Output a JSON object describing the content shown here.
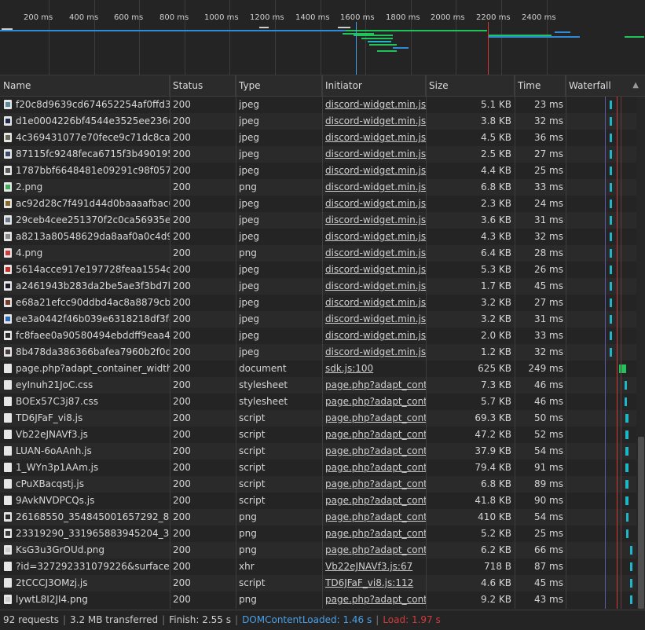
{
  "overview": {
    "ticks": [
      "200 ms",
      "400 ms",
      "600 ms",
      "800 ms",
      "1000 ms",
      "1200 ms",
      "1400 ms",
      "1600 ms",
      "1800 ms",
      "2000 ms",
      "2200 ms",
      "2400 ms"
    ]
  },
  "columns": {
    "name": "Name",
    "status": "Status",
    "type": "Type",
    "initiator": "Initiator",
    "size": "Size",
    "time": "Time",
    "waterfall": "Waterfall"
  },
  "rows": [
    {
      "name": "f20c8d9639cd674652254af0ffd3e...",
      "status": "200",
      "type": "jpeg",
      "initiator": "discord-widget.min.js:1",
      "size": "5.1 KB",
      "time": "23 ms",
      "icon": "image-file-icon",
      "color": "#5a8a9a"
    },
    {
      "name": "d1e0004226bf4544e3525ee236cd...",
      "status": "200",
      "type": "jpeg",
      "initiator": "discord-widget.min.js:1",
      "size": "3.8 KB",
      "time": "32 ms",
      "icon": "image-file-icon",
      "color": "#1d2b52"
    },
    {
      "name": "4c369431077e70fece9c71dc8ca28...",
      "status": "200",
      "type": "jpeg",
      "initiator": "discord-widget.min.js:1",
      "size": "4.5 KB",
      "time": "36 ms",
      "icon": "image-file-icon",
      "color": "#6a6a5a"
    },
    {
      "name": "87115fc9248feca6715f3b4901956...",
      "status": "200",
      "type": "jpeg",
      "initiator": "discord-widget.min.js:1",
      "size": "2.5 KB",
      "time": "27 ms",
      "icon": "image-file-icon",
      "color": "#3a4a6a"
    },
    {
      "name": "1787bbf6648481e09291c98f0577...",
      "status": "200",
      "type": "jpeg",
      "initiator": "discord-widget.min.js:1",
      "size": "4.4 KB",
      "time": "25 ms",
      "icon": "image-file-icon",
      "color": "#5a5a5a"
    },
    {
      "name": "2.png",
      "status": "200",
      "type": "png",
      "initiator": "discord-widget.min.js:1",
      "size": "6.8 KB",
      "time": "33 ms",
      "icon": "image-file-icon",
      "color": "#3fae5a"
    },
    {
      "name": "ac92d28c7f491d44d0baaaafbac60...",
      "status": "200",
      "type": "jpeg",
      "initiator": "discord-widget.min.js:1",
      "size": "2.3 KB",
      "time": "24 ms",
      "icon": "image-file-icon",
      "color": "#8a6a2a"
    },
    {
      "name": "29ceb4cee251370f2c0ca56935ea0...",
      "status": "200",
      "type": "jpeg",
      "initiator": "discord-widget.min.js:1",
      "size": "3.6 KB",
      "time": "31 ms",
      "icon": "image-file-icon",
      "color": "#6a7a8a"
    },
    {
      "name": "a8213a80548629da8aaf0a0c4d93...",
      "status": "200",
      "type": "jpeg",
      "initiator": "discord-widget.min.js:1",
      "size": "4.3 KB",
      "time": "32 ms",
      "icon": "image-file-icon",
      "color": "#8a8a8a"
    },
    {
      "name": "4.png",
      "status": "200",
      "type": "png",
      "initiator": "discord-widget.min.js:1",
      "size": "6.4 KB",
      "time": "28 ms",
      "icon": "image-file-icon",
      "color": "#d03a3a"
    },
    {
      "name": "5614acce917e197728feaa1554c64...",
      "status": "200",
      "type": "jpeg",
      "initiator": "discord-widget.min.js:1",
      "size": "5.3 KB",
      "time": "26 ms",
      "icon": "image-file-icon",
      "color": "#c0302a"
    },
    {
      "name": "a2461943b283da2be5ae3f3bd7bc...",
      "status": "200",
      "type": "jpeg",
      "initiator": "discord-widget.min.js:1",
      "size": "1.7 KB",
      "time": "45 ms",
      "icon": "image-file-icon",
      "color": "#1a1a2a"
    },
    {
      "name": "e68a21efcc90ddbd4ac8a8879cb2...",
      "status": "200",
      "type": "jpeg",
      "initiator": "discord-widget.min.js:1",
      "size": "3.2 KB",
      "time": "27 ms",
      "icon": "image-file-icon",
      "color": "#7a3a2a"
    },
    {
      "name": "ee3a0442f46b039e6318218df3f85...",
      "status": "200",
      "type": "jpeg",
      "initiator": "discord-widget.min.js:1",
      "size": "3.2 KB",
      "time": "31 ms",
      "icon": "image-file-icon",
      "color": "#2a6ac0"
    },
    {
      "name": "fc8faee0a90580494ebddff9eaa46...",
      "status": "200",
      "type": "jpeg",
      "initiator": "discord-widget.min.js:1",
      "size": "2.0 KB",
      "time": "33 ms",
      "icon": "image-file-icon",
      "color": "#2a2a2a"
    },
    {
      "name": "8b478da386366bafea7960b2f0d5...",
      "status": "200",
      "type": "jpeg",
      "initiator": "discord-widget.min.js:1",
      "size": "1.2 KB",
      "time": "32 ms",
      "icon": "image-file-icon",
      "color": "#4a3a3a"
    },
    {
      "name": "page.php?adapt_container_width...",
      "status": "200",
      "type": "document",
      "initiator": "sdk.js:100",
      "size": "625 KB",
      "time": "249 ms",
      "icon": "document-file-icon",
      "color": ""
    },
    {
      "name": "eyInuh21JoC.css",
      "status": "200",
      "type": "stylesheet",
      "initiator": "page.php?adapt_cont...",
      "size": "7.3 KB",
      "time": "46 ms",
      "icon": "stylesheet-file-icon",
      "color": ""
    },
    {
      "name": "BOEx57C3j87.css",
      "status": "200",
      "type": "stylesheet",
      "initiator": "page.php?adapt_cont...",
      "size": "5.7 KB",
      "time": "46 ms",
      "icon": "stylesheet-file-icon",
      "color": ""
    },
    {
      "name": "TD6JFaF_vi8.js",
      "status": "200",
      "type": "script",
      "initiator": "page.php?adapt_cont...",
      "size": "69.3 KB",
      "time": "50 ms",
      "icon": "script-file-icon",
      "color": ""
    },
    {
      "name": "Vb22eJNAVf3.js",
      "status": "200",
      "type": "script",
      "initiator": "page.php?adapt_cont...",
      "size": "47.2 KB",
      "time": "52 ms",
      "icon": "script-file-icon",
      "color": ""
    },
    {
      "name": "LUAN-6oAAnh.js",
      "status": "200",
      "type": "script",
      "initiator": "page.php?adapt_cont...",
      "size": "37.9 KB",
      "time": "54 ms",
      "icon": "script-file-icon",
      "color": ""
    },
    {
      "name": "1_WYn3p1AAm.js",
      "status": "200",
      "type": "script",
      "initiator": "page.php?adapt_cont...",
      "size": "79.4 KB",
      "time": "91 ms",
      "icon": "script-file-icon",
      "color": ""
    },
    {
      "name": "cPuXBacqstj.js",
      "status": "200",
      "type": "script",
      "initiator": "page.php?adapt_cont...",
      "size": "6.8 KB",
      "time": "89 ms",
      "icon": "script-file-icon",
      "color": ""
    },
    {
      "name": "9AvkNVDPCQs.js",
      "status": "200",
      "type": "script",
      "initiator": "page.php?adapt_cont...",
      "size": "41.8 KB",
      "time": "90 ms",
      "icon": "script-file-icon",
      "color": ""
    },
    {
      "name": "26168550_354845001657292_817...",
      "status": "200",
      "type": "png",
      "initiator": "page.php?adapt_cont...",
      "size": "410 KB",
      "time": "54 ms",
      "icon": "image-file-icon",
      "color": "#2a2a2a"
    },
    {
      "name": "23319290_331965883945204_311...",
      "status": "200",
      "type": "png",
      "initiator": "page.php?adapt_cont...",
      "size": "5.2 KB",
      "time": "25 ms",
      "icon": "image-file-icon",
      "color": "#3a3a3a"
    },
    {
      "name": "KsG3u3GrOUd.png",
      "status": "200",
      "type": "png",
      "initiator": "page.php?adapt_cont...",
      "size": "6.2 KB",
      "time": "66 ms",
      "icon": "image-file-icon",
      "color": "#cccccc"
    },
    {
      "name": "?id=327292331079226&surface=...",
      "status": "200",
      "type": "xhr",
      "initiator": "Vb22eJNAVf3.js:67",
      "size": "718 B",
      "time": "87 ms",
      "icon": "xhr-file-icon",
      "color": ""
    },
    {
      "name": "2tCCCJ3OMzj.js",
      "status": "200",
      "type": "script",
      "initiator": "TD6JFaF_vi8.js:112",
      "size": "4.6 KB",
      "time": "45 ms",
      "icon": "script-file-icon",
      "color": ""
    },
    {
      "name": "lywtL8I2JI4.png",
      "status": "200",
      "type": "png",
      "initiator": "page.php?adapt_cont...",
      "size": "9.2 KB",
      "time": "43 ms",
      "icon": "image-file-icon",
      "color": "#cccccc"
    }
  ],
  "status_bar": {
    "requests": "92 requests",
    "transferred": "3.2 MB transferred",
    "finish": "Finish: 2.55 s",
    "dom_content_loaded": "DOMContentLoaded: 1.46 s",
    "load": "Load: 1.97 s"
  },
  "colors": {
    "dcl_line": "#4aa0e6",
    "load_line": "#d33b3b",
    "bar_green": "#22c35a",
    "bar_cyan": "#1fb6c8",
    "bar_blue": "#2f8ad8"
  }
}
